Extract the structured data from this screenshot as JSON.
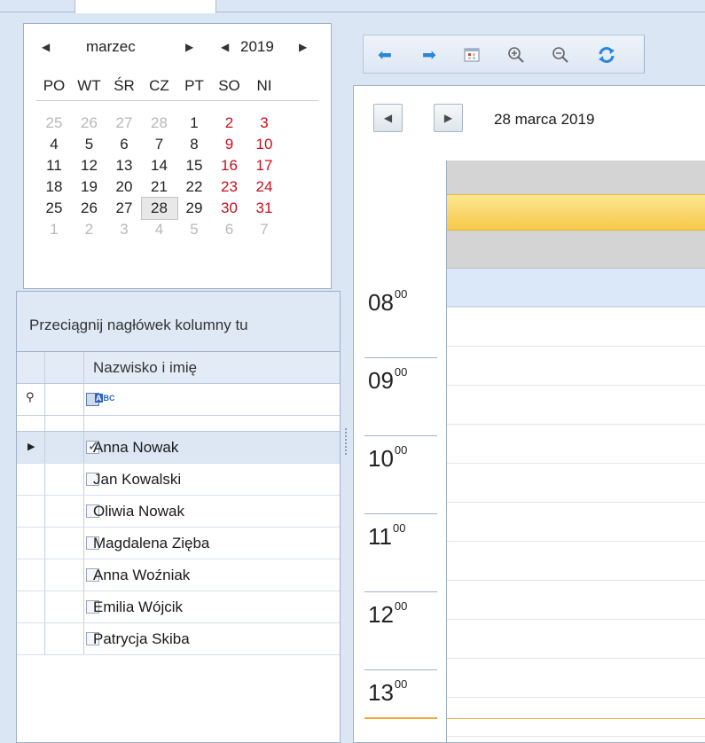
{
  "calendar": {
    "month": "marzec",
    "year": "2019",
    "weekdays": [
      "PO",
      "WT",
      "ŚR",
      "CZ",
      "PT",
      "SO",
      "NI"
    ],
    "weeks": [
      [
        {
          "d": "25",
          "t": "grey"
        },
        {
          "d": "26",
          "t": "grey"
        },
        {
          "d": "27",
          "t": "grey"
        },
        {
          "d": "28",
          "t": "grey"
        },
        {
          "d": "1",
          "t": "norm"
        },
        {
          "d": "2",
          "t": "red"
        },
        {
          "d": "3",
          "t": "red"
        }
      ],
      [
        {
          "d": "4",
          "t": "norm"
        },
        {
          "d": "5",
          "t": "norm"
        },
        {
          "d": "6",
          "t": "norm"
        },
        {
          "d": "7",
          "t": "norm"
        },
        {
          "d": "8",
          "t": "norm"
        },
        {
          "d": "9",
          "t": "red"
        },
        {
          "d": "10",
          "t": "red"
        }
      ],
      [
        {
          "d": "11",
          "t": "norm"
        },
        {
          "d": "12",
          "t": "norm"
        },
        {
          "d": "13",
          "t": "norm"
        },
        {
          "d": "14",
          "t": "norm"
        },
        {
          "d": "15",
          "t": "norm"
        },
        {
          "d": "16",
          "t": "red"
        },
        {
          "d": "17",
          "t": "red"
        }
      ],
      [
        {
          "d": "18",
          "t": "norm"
        },
        {
          "d": "19",
          "t": "norm"
        },
        {
          "d": "20",
          "t": "norm"
        },
        {
          "d": "21",
          "t": "norm"
        },
        {
          "d": "22",
          "t": "norm"
        },
        {
          "d": "23",
          "t": "red"
        },
        {
          "d": "24",
          "t": "red"
        }
      ],
      [
        {
          "d": "25",
          "t": "norm"
        },
        {
          "d": "26",
          "t": "norm"
        },
        {
          "d": "27",
          "t": "norm"
        },
        {
          "d": "28",
          "t": "today"
        },
        {
          "d": "29",
          "t": "norm"
        },
        {
          "d": "30",
          "t": "red"
        },
        {
          "d": "31",
          "t": "red"
        }
      ],
      [
        {
          "d": "1",
          "t": "grey"
        },
        {
          "d": "2",
          "t": "grey"
        },
        {
          "d": "3",
          "t": "grey"
        },
        {
          "d": "4",
          "t": "grey"
        },
        {
          "d": "5",
          "t": "grey"
        },
        {
          "d": "6",
          "t": "grey"
        },
        {
          "d": "7",
          "t": "grey"
        }
      ]
    ]
  },
  "grid": {
    "group_panel_text": "Przeciągnij nagłówek kolumny tu",
    "column_header": "Nazwisko i imię",
    "filter_type_label": "BC",
    "filter_type_badge": "A",
    "rows": [
      {
        "name": "Anna Nowak",
        "checked": true,
        "selected": true
      },
      {
        "name": "Jan Kowalski",
        "checked": false,
        "selected": false
      },
      {
        "name": "Oliwia Nowak",
        "checked": false,
        "selected": false
      },
      {
        "name": "Magdalena Zięba",
        "checked": false,
        "selected": false
      },
      {
        "name": "Anna Woźniak",
        "checked": false,
        "selected": false
      },
      {
        "name": "Emilia Wójcik",
        "checked": false,
        "selected": false
      },
      {
        "name": "Patrycja Skiba",
        "checked": false,
        "selected": false
      }
    ]
  },
  "toolbar": {
    "icons": [
      "arrow-left-icon",
      "arrow-right-icon",
      "calendar-icon",
      "zoom-in-icon",
      "zoom-out-icon",
      "refresh-icon"
    ]
  },
  "schedule": {
    "date_label": "28 marca 2019",
    "hours": [
      {
        "h": "08",
        "m": "00"
      },
      {
        "h": "09",
        "m": "00"
      },
      {
        "h": "10",
        "m": "00"
      },
      {
        "h": "11",
        "m": "00"
      },
      {
        "h": "12",
        "m": "00"
      },
      {
        "h": "13",
        "m": "00"
      }
    ]
  },
  "colors": {
    "accent_blue": "#2a86d8",
    "weekend_red": "#c8101d",
    "event_yellow": "#fbd35e",
    "current_time_orange": "#f2a53b",
    "selection_blue": "#dbe8fa",
    "band_grey": "#d4d4d4"
  }
}
